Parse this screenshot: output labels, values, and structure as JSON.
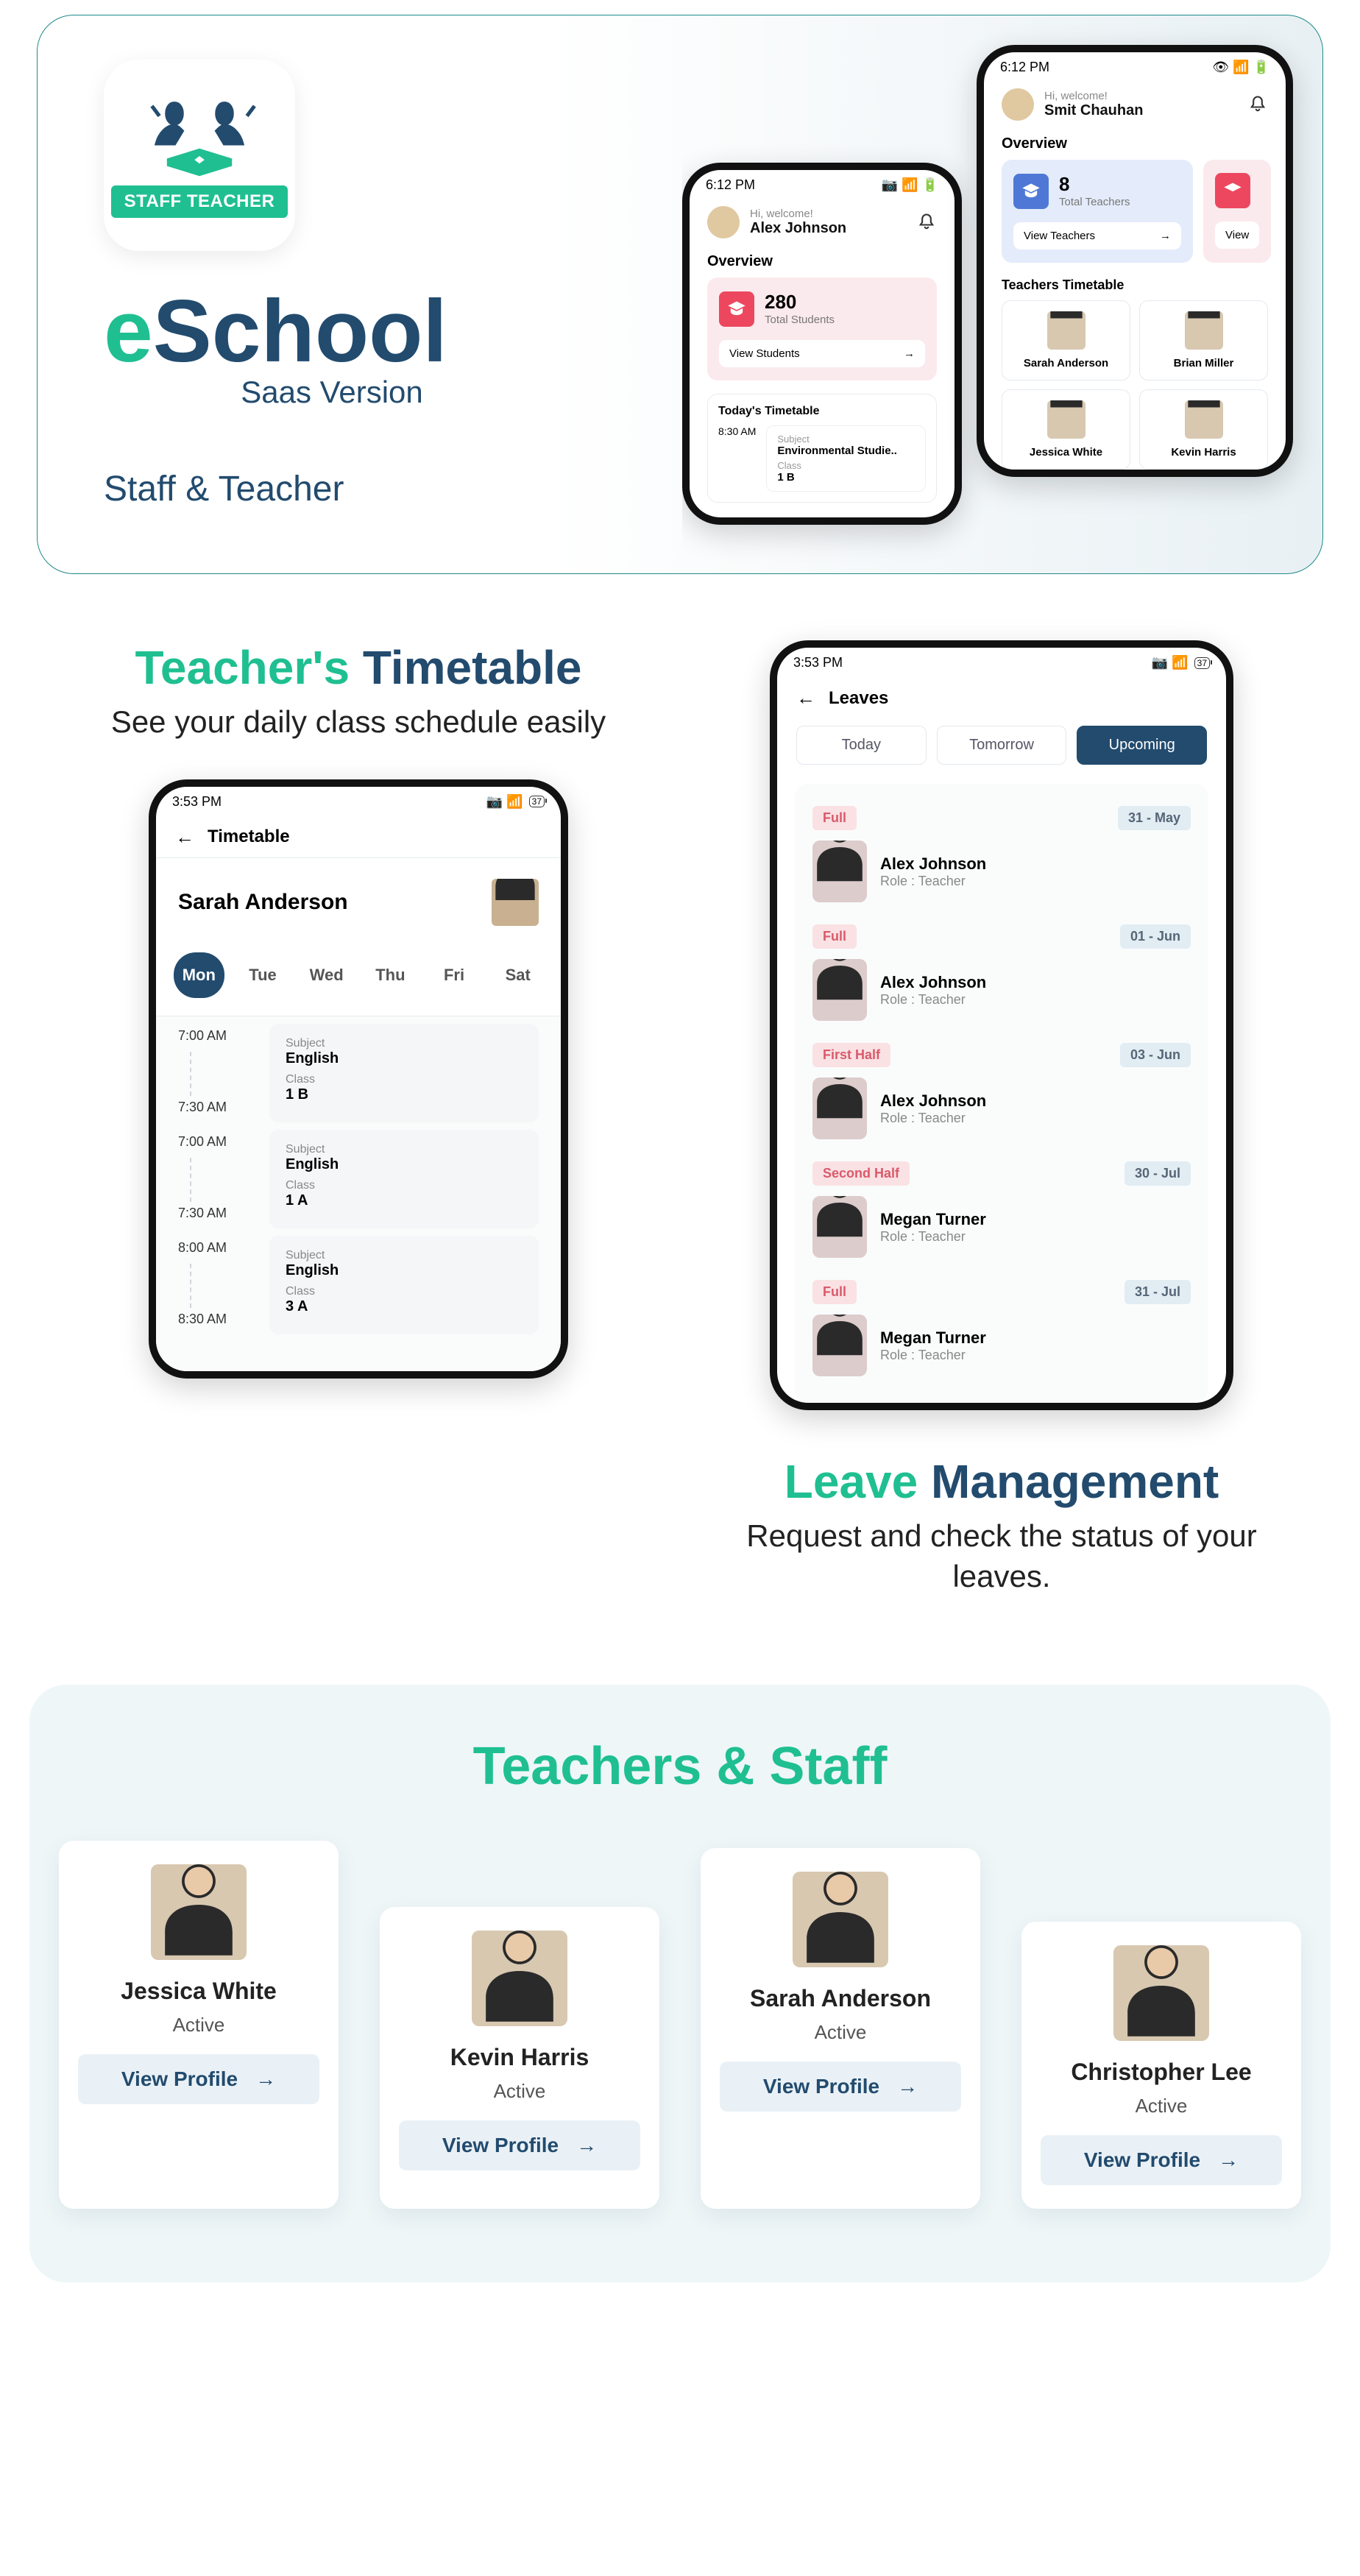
{
  "hero": {
    "logo_badge": "STAFF TEACHER",
    "title_e": "e",
    "title_rest": "School",
    "sub": "Saas Version",
    "tag": "Staff & Teacher",
    "phone1": {
      "time": "6:12 PM",
      "welcome": "Hi, welcome!",
      "user": "Alex Johnson",
      "overview": "Overview",
      "card1_num": "280",
      "card1_label": "Total Students",
      "card1_link": "View Students",
      "tt_title": "Today's Timetable",
      "tt_time": "8:30 AM",
      "tt_sub_lbl": "Subject",
      "tt_sub": "Environmental Studie..",
      "tt_cls_lbl": "Class",
      "tt_cls": "1 B"
    },
    "phone2": {
      "time": "6:12 PM",
      "welcome": "Hi, welcome!",
      "user": "Smit Chauhan",
      "overview": "Overview",
      "card1_num": "8",
      "card1_label": "Total Teachers",
      "card1_link": "View Teachers",
      "card2_link": "View",
      "tt_title": "Teachers Timetable",
      "t1": "Sarah Anderson",
      "t2": "Brian Miller",
      "t3": "Jessica White",
      "t4": "Kevin Harris"
    }
  },
  "s2": {
    "left_h1_a": "Teacher's ",
    "left_h1_b": "Timetable",
    "left_sub": "See your daily class schedule easily",
    "right_h1_a": "Leave ",
    "right_h1_b": "Management",
    "right_sub": "Request and check the status of your leaves.",
    "tt_phone": {
      "time": "3:53 PM",
      "batt": "37",
      "title": "Timetable",
      "name": "Sarah Anderson",
      "days": [
        "Mon",
        "Tue",
        "Wed",
        "Thu",
        "Fri",
        "Sat"
      ],
      "rows": [
        {
          "t1": "7:00 AM",
          "t2": "7:30 AM",
          "sub": "English",
          "cls": "1 B"
        },
        {
          "t1": "7:00 AM",
          "t2": "7:30 AM",
          "sub": "English",
          "cls": "1 A"
        },
        {
          "t1": "8:00 AM",
          "t2": "8:30 AM",
          "sub": "English",
          "cls": "3 A"
        }
      ],
      "sub_lbl": "Subject",
      "cls_lbl": "Class"
    },
    "lv_phone": {
      "time": "3:53 PM",
      "batt": "37",
      "title": "Leaves",
      "tabs": [
        "Today",
        "Tomorrow",
        "Upcoming"
      ],
      "items": [
        {
          "type": "Full",
          "date": "31 - May",
          "name": "Alex Johnson",
          "role": "Role : Teacher"
        },
        {
          "type": "Full",
          "date": "01 - Jun",
          "name": "Alex Johnson",
          "role": "Role : Teacher"
        },
        {
          "type": "First Half",
          "date": "03 - Jun",
          "name": "Alex Johnson",
          "role": "Role : Teacher"
        },
        {
          "type": "Second Half",
          "date": "30 - Jul",
          "name": "Megan Turner",
          "role": "Role : Teacher"
        },
        {
          "type": "Full",
          "date": "31 - Jul",
          "name": "Megan Turner",
          "role": "Role : Teacher"
        }
      ]
    }
  },
  "s3": {
    "title": "Teachers & Staff",
    "view_label": "View Profile",
    "staff": [
      {
        "name": "Jessica White",
        "status": "Active"
      },
      {
        "name": "Kevin Harris",
        "status": "Active"
      },
      {
        "name": "Sarah Anderson",
        "status": "Active"
      },
      {
        "name": "Christopher Lee",
        "status": "Active"
      }
    ]
  }
}
